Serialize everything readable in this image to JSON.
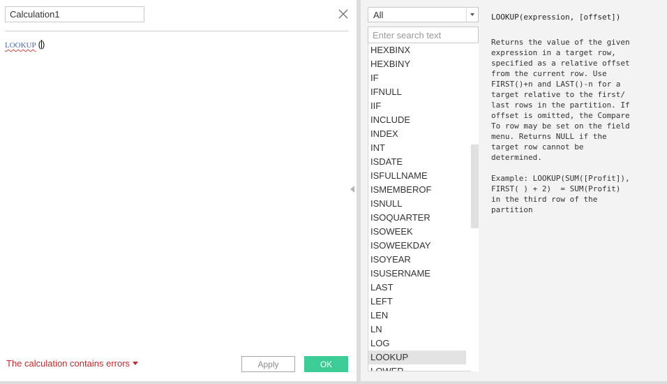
{
  "editor": {
    "calc_name": "Calculation1",
    "formula_keyword": "LOOKUP",
    "formula_space": " ",
    "formula_paren_open": "(",
    "formula_paren_close": ")"
  },
  "footer": {
    "error_text": "The calculation contains errors",
    "apply_label": "Apply",
    "ok_label": "OK"
  },
  "functions": {
    "category": "All",
    "search_placeholder": "Enter search text",
    "items": [
      "HEXBINX",
      "HEXBINY",
      "IF",
      "IFNULL",
      "IIF",
      "INCLUDE",
      "INDEX",
      "INT",
      "ISDATE",
      "ISFULLNAME",
      "ISMEMBEROF",
      "ISNULL",
      "ISOQUARTER",
      "ISOWEEK",
      "ISOWEEKDAY",
      "ISOYEAR",
      "ISUSERNAME",
      "LAST",
      "LEFT",
      "LEN",
      "LN",
      "LOG",
      "LOOKUP",
      "LOWER"
    ],
    "selected": "LOOKUP"
  },
  "help": {
    "signature": "LOOKUP(expression, [offset])",
    "description_lines": [
      "Returns the value of the given",
      "expression in a target row,",
      "specified as a relative offset",
      "from the current row. Use",
      "FIRST()+n and LAST()-n for a",
      "target relative to the first/",
      "last rows in the partition. If",
      "offset is omitted, the Compare",
      "To row may be set on the field",
      "menu. Returns NULL if the",
      "target row cannot be",
      "determined."
    ],
    "example_lines": [
      "Example: LOOKUP(SUM([Profit]),",
      "FIRST( ) + 2)  = SUM(Profit)",
      "in the third row of the",
      "partition"
    ]
  },
  "icons": {
    "close": "close-icon",
    "dropdown": "chevron-down-icon",
    "error_caret": "caret-down-icon",
    "collapse": "collapse-arrow-icon"
  },
  "colors": {
    "ok_button": "#3dcc96",
    "error_text": "#c0282d",
    "keyword": "#4a64a8",
    "right_pane_bg": "#f3f3f3",
    "selected_item": "#e3e3e3"
  }
}
